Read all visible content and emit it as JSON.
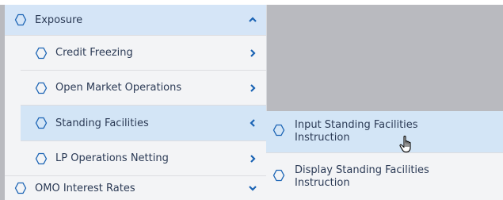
{
  "colors": {
    "accent": "#1a63b4",
    "highlight": "#d3e5f6",
    "menu_bg": "#f3f4f6",
    "backdrop": "#b9babf",
    "text": "#2b3a55"
  },
  "menu": {
    "items": [
      {
        "label": "Exposure",
        "level": 0,
        "state": "expanded",
        "chevron": "chevron-up-icon"
      },
      {
        "label": "Credit Freezing",
        "level": 1,
        "chevron": "chevron-right-icon"
      },
      {
        "label": "Open Market Operations",
        "level": 1,
        "chevron": "chevron-right-icon"
      },
      {
        "label": "Standing Facilities",
        "level": 1,
        "state": "open",
        "chevron": "chevron-left-icon"
      },
      {
        "label": "LP Operations Netting",
        "level": 1,
        "chevron": "chevron-right-icon"
      },
      {
        "label": "OMO Interest Rates",
        "level": 0,
        "chevron": "chevron-down-icon"
      }
    ]
  },
  "submenu": {
    "items": [
      {
        "line1": "Input Standing Facilities",
        "line2": "Instruction"
      },
      {
        "line1": "Display Standing Facilities",
        "line2": "Instruction"
      }
    ]
  }
}
